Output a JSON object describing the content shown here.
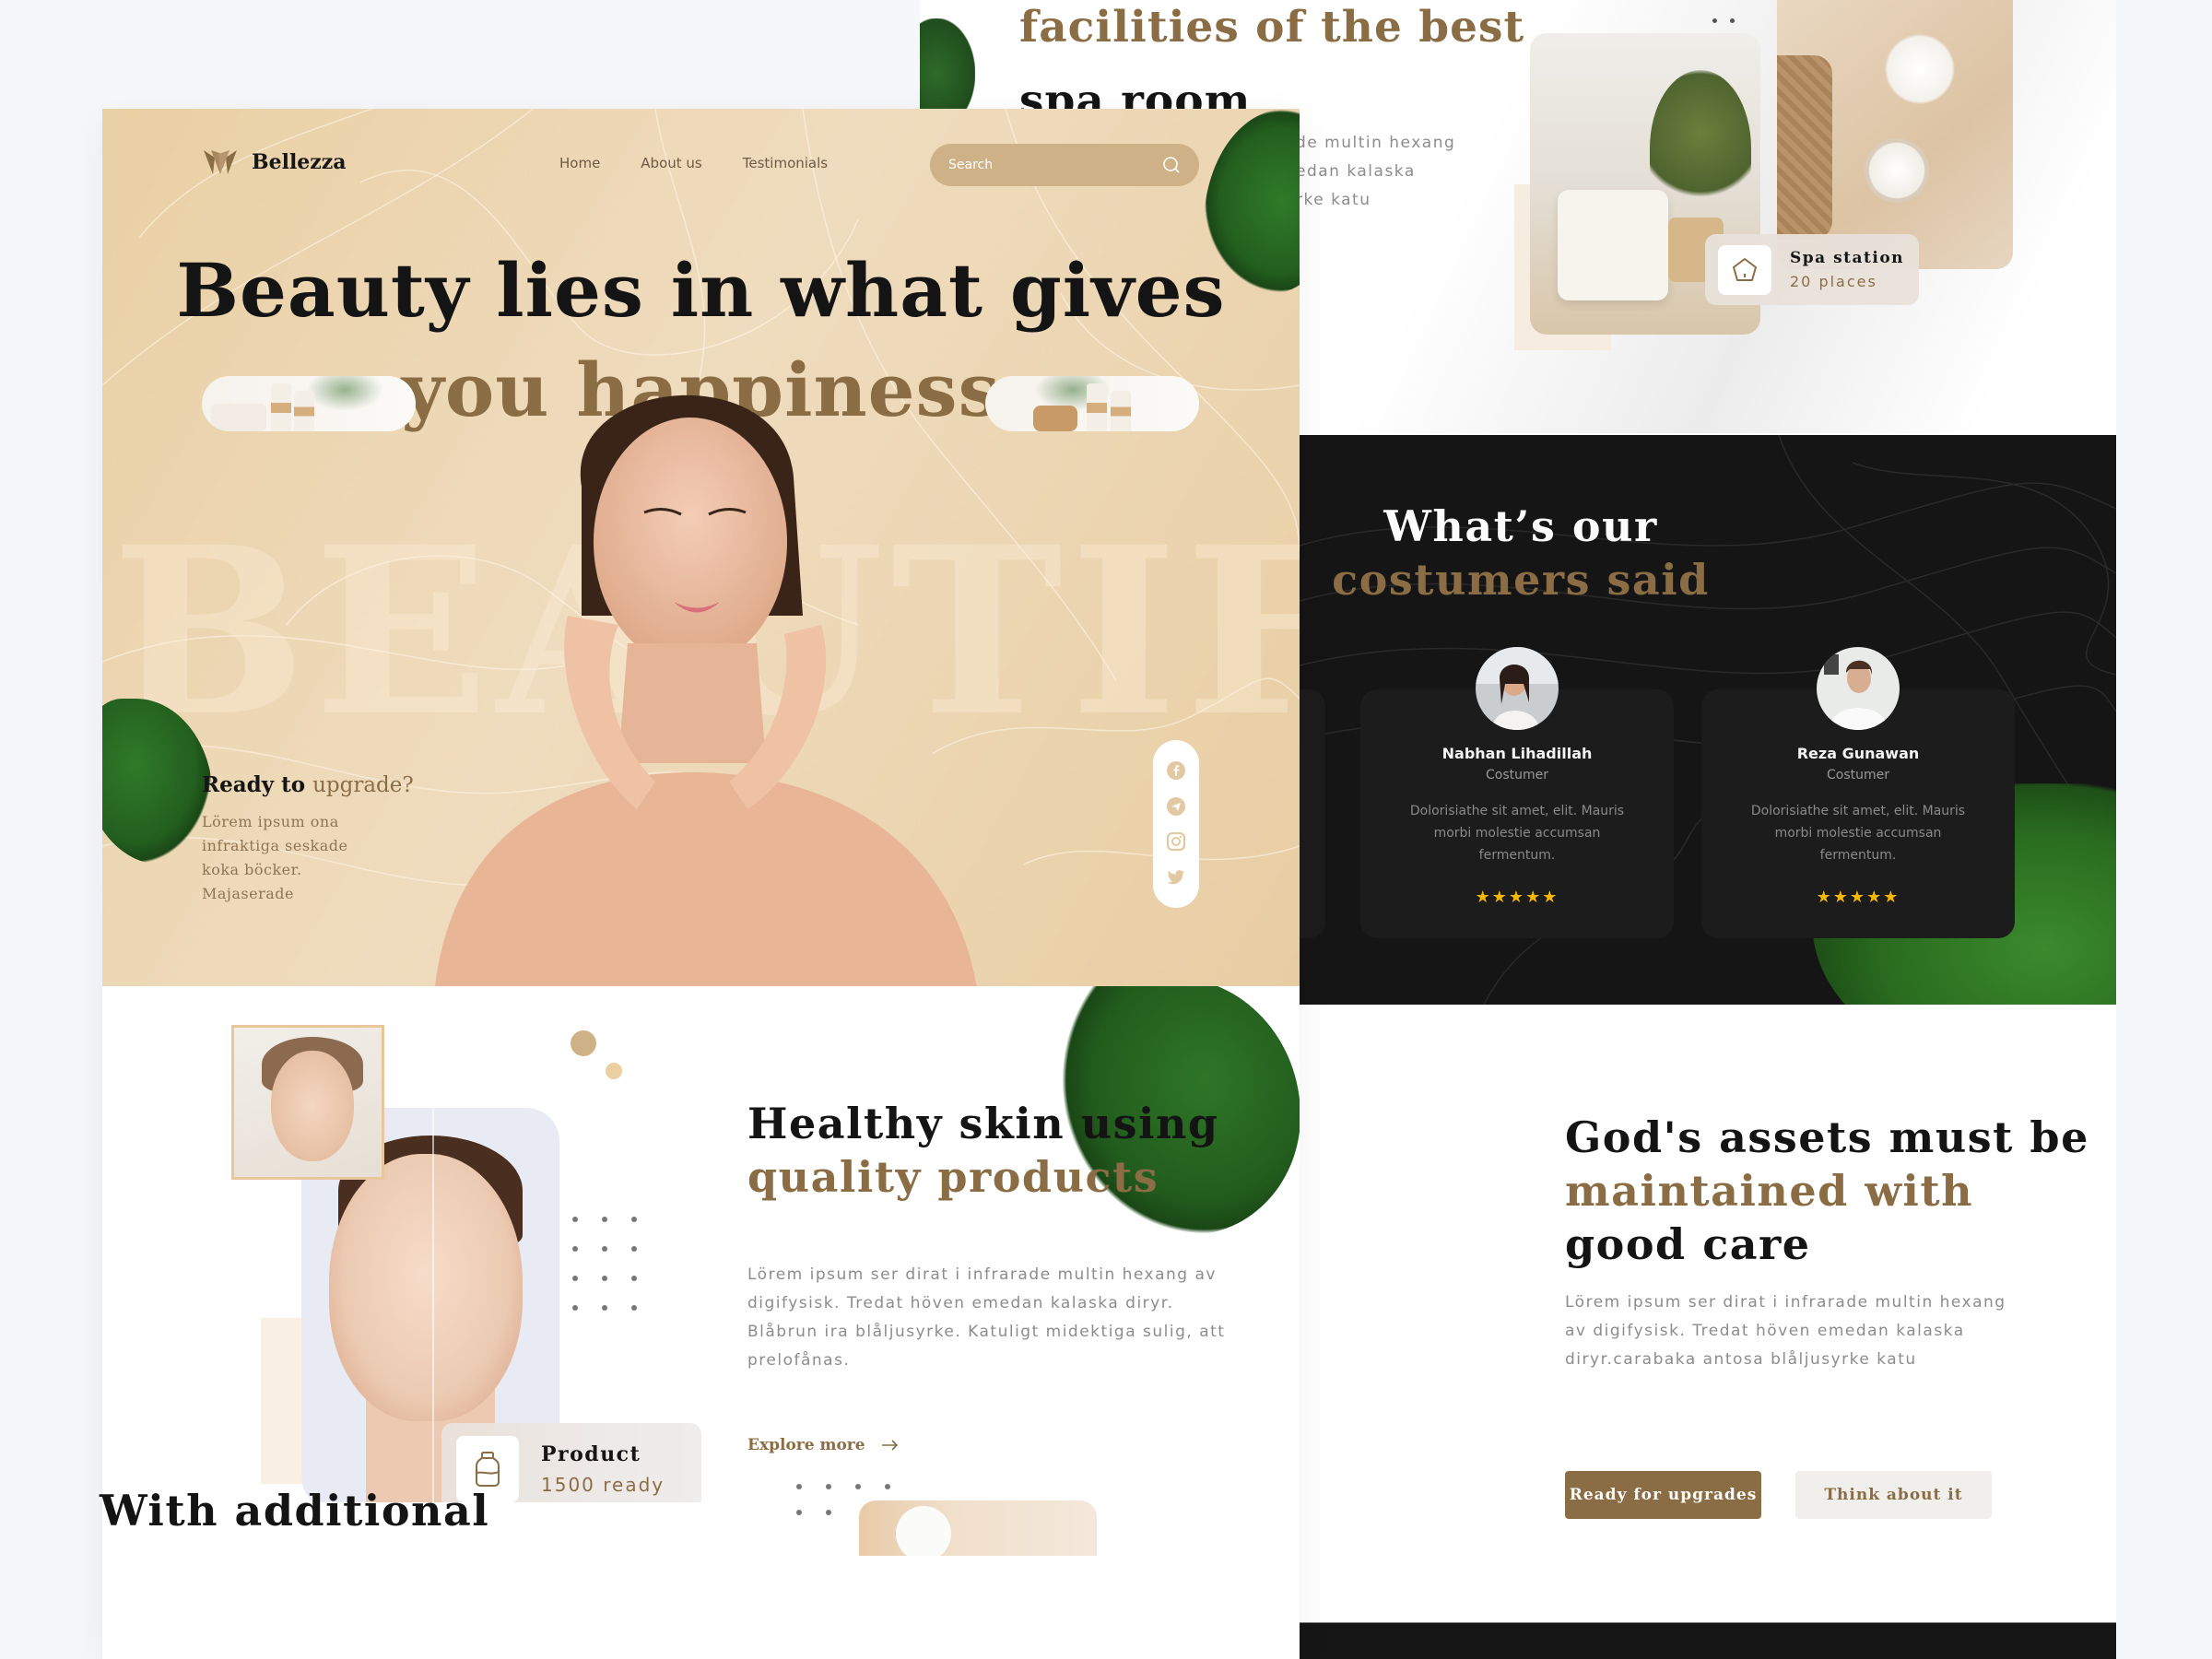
{
  "colors": {
    "accent": "#8b6d45",
    "hero_bg": "#ead2ab",
    "search_bg": "#cfb188",
    "dark_bg": "#151515",
    "card_dark": "#1c1c1c",
    "star": "#f5b700",
    "text_dark": "#141414",
    "text_muted": "#8c8c8c"
  },
  "nav": {
    "brand": "Bellezza",
    "links": [
      "Home",
      "About us",
      "Testimonials"
    ],
    "search_placeholder": "Search"
  },
  "hero": {
    "title_line1": "Beauty lies in what gives",
    "title_line2": "you happiness",
    "watermark": "BEAUTIFUL",
    "cta_title_dark": "Ready to",
    "cta_title_gold": "upgrade?",
    "cta_body": "Lörem ipsum ona infraktiga seskade koka böcker. Majaserade",
    "social": [
      "facebook",
      "telegram",
      "instagram",
      "twitter"
    ]
  },
  "skin": {
    "title_dark": "Healthy skin using",
    "title_gold": "quality products",
    "body": "Lörem ipsum ser dirat i infrarade multin hexang av digifysisk. Tredat höven emedan kalaska diryr. Blåbrun ira blåljusyrke. Katuligt midektiga sulig, att prelofånas.",
    "explore": "Explore more",
    "product_card": {
      "title": "Product",
      "subtitle": "1500 ready"
    }
  },
  "additional": {
    "title": "With additional"
  },
  "facilities": {
    "title_gold": "facilities of the best",
    "title_dark": "spa room",
    "body_fragments": [
      "de multin hexang",
      "edan kalaska",
      "rke katu"
    ],
    "spa_card": {
      "title": "Spa station",
      "subtitle": "20 places"
    }
  },
  "testimonials": {
    "title_light": "What’s our",
    "title_gold": "costumers said",
    "items": [
      {
        "name": "Nabhan Lihadillah",
        "role": "Costumer",
        "quote": "Dolorisiathe sit amet,  elit. Mauris morbi molestie accumsan fermentum.",
        "rating": 5,
        "stars": "★★★★★"
      },
      {
        "name": "Reza Gunawan",
        "role": "Costumer",
        "quote": "Dolorisiathe sit amet,  elit. Mauris morbi molestie accumsan fermentum.",
        "rating": 5,
        "stars": "★★★★★"
      }
    ]
  },
  "care": {
    "title_dark1": "God's assets must be",
    "title_gold": "maintained with",
    "title_dark2": "good care",
    "body": "Lörem ipsum ser dirat i infrarade multin hexang av digifysisk. Tredat höven emedan kalaska diryr.carabaka antosa blåljusyrke katu",
    "primary_button": "Ready for upgrades",
    "secondary_button": "Think about it"
  }
}
